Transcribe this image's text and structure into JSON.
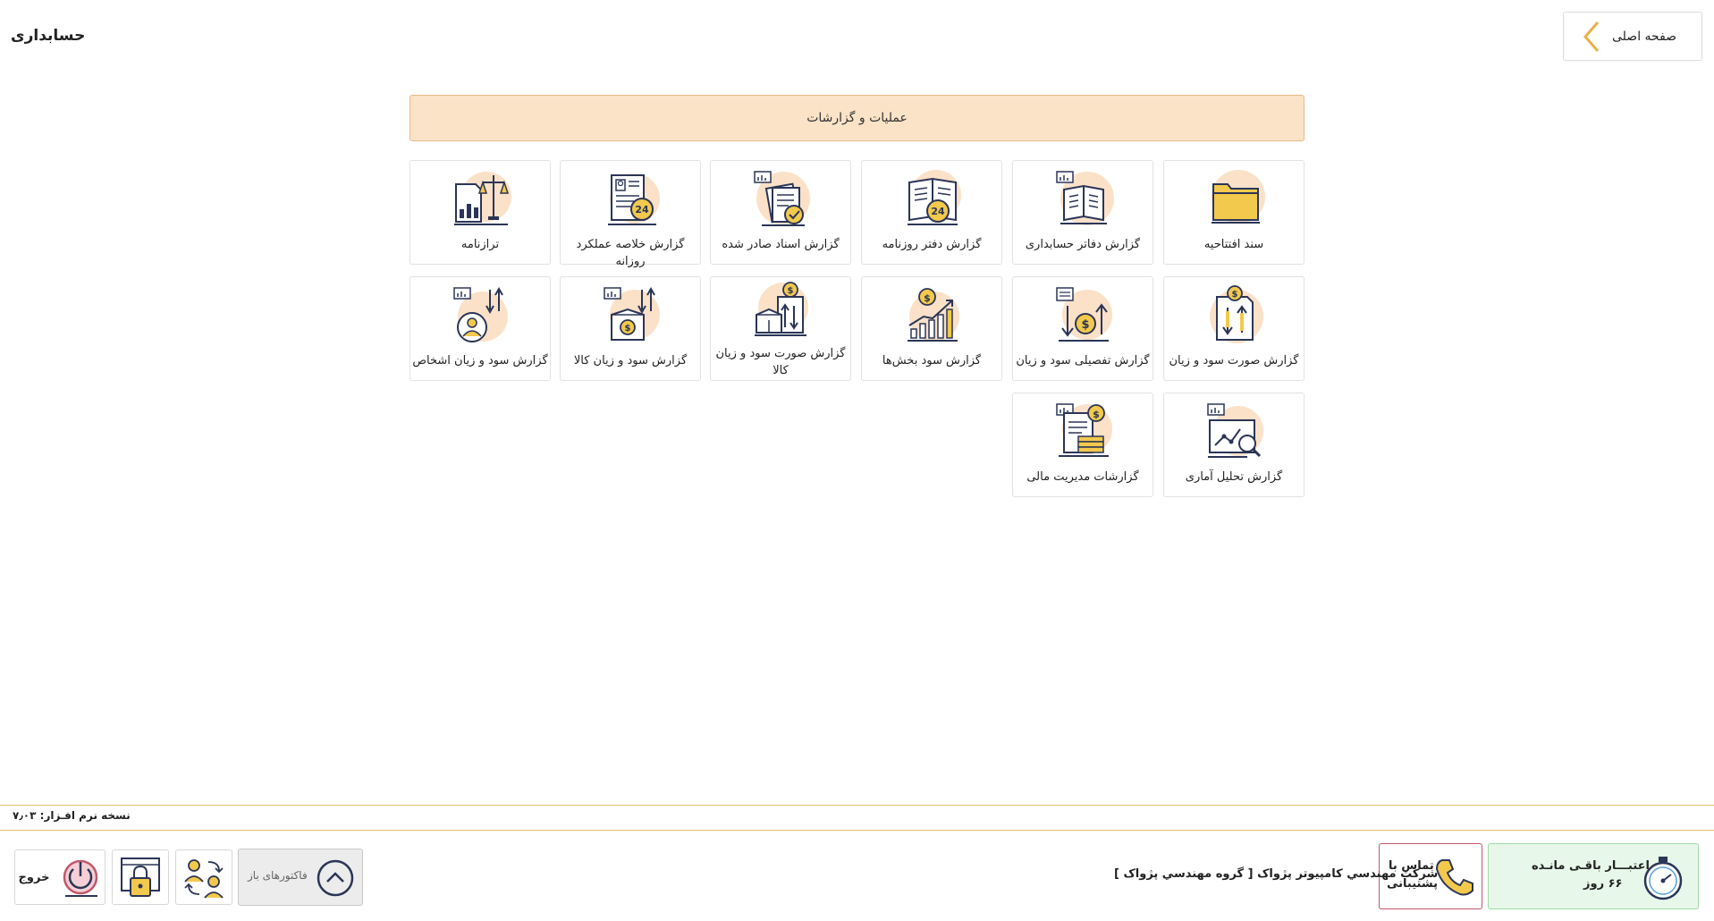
{
  "page": {
    "title": "حسابداری"
  },
  "header": {
    "home_label": "صفحه اصلی"
  },
  "section": {
    "title": "عملیات و گزارشات"
  },
  "tiles": [
    {
      "label": "سند افتتاحیه",
      "icon": "folder-icon"
    },
    {
      "label": "گزارش دفاتر حسابداری",
      "icon": "ledger-book-icon"
    },
    {
      "label": "گزارش دفتر روزنامه",
      "icon": "journal-24-icon"
    },
    {
      "label": "گزارش اسناد صادر شده",
      "icon": "issued-documents-icon"
    },
    {
      "label": "گزارش خلاصه عملکرد روزانه",
      "icon": "daily-summary-icon"
    },
    {
      "label": "ترازنامه",
      "icon": "balance-sheet-icon"
    },
    {
      "label": "گزارش صورت سود و زیان",
      "icon": "profit-loss-document-icon"
    },
    {
      "label": "گزارش تفصیلی سود و زیان",
      "icon": "detailed-profit-loss-icon"
    },
    {
      "label": "گزارش  سود بخش‌ها",
      "icon": "growth-chart-icon"
    },
    {
      "label": "گزارش صورت سود و زیان کالا",
      "icon": "product-profit-statement-icon"
    },
    {
      "label": "گزارش سود و زیان کالا",
      "icon": "product-box-icon"
    },
    {
      "label": "گزارش سود و زیان اشخاص",
      "icon": "person-profit-icon"
    },
    {
      "label": "گزارش تحلیل آماری",
      "icon": "statistical-analysis-icon"
    },
    {
      "label": "گزارشات مدیریت مالی",
      "icon": "financial-management-icon"
    }
  ],
  "footer": {
    "version": "نسخه نرم افـزار: ۷٫۰۳",
    "credit_line1": "اعتبـــار باقـی مانـده",
    "credit_line2": "۶۶ روز",
    "support_line1": "تماس با",
    "support_line2": "پشتیبانی",
    "company": "شرکت مهندسي كامپيوتر پژواک [ گروه مهندسي پژواک ]",
    "open_invoices": "فاکتورهای باز",
    "exit": "خروج"
  },
  "colors": {
    "accent": "#e8b04a",
    "header_bg": "#fbe3c7",
    "icon_circle": "#fbe1c8",
    "icon_stroke": "#2b3557",
    "icon_fill": "#f2c94c"
  }
}
